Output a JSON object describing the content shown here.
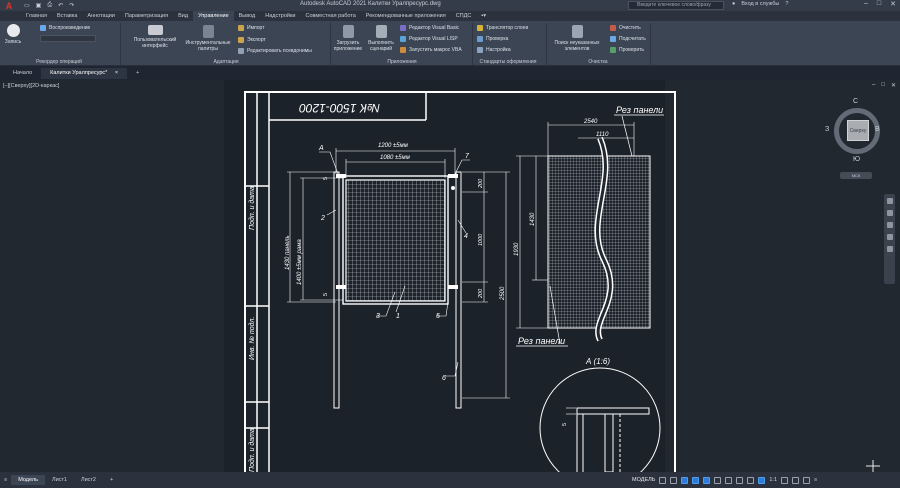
{
  "app": {
    "logo_letter": "A",
    "window_title": "Autodesk AutoCAD 2021    Калитки Уралпресурс.dwg",
    "search_placeholder": "Введите ключевое слово/фразу",
    "sign_in": "Вход в службы",
    "help": "?"
  },
  "quick_access": [
    "▭",
    "▣",
    "⎙",
    "↶",
    "↷"
  ],
  "ribbon_tabs": [
    {
      "label": "Главная",
      "active": false
    },
    {
      "label": "Вставка",
      "active": false
    },
    {
      "label": "Аннотации",
      "active": false
    },
    {
      "label": "Параметризация",
      "active": false
    },
    {
      "label": "Вид",
      "active": false
    },
    {
      "label": "Управление",
      "active": true
    },
    {
      "label": "Вывод",
      "active": false
    },
    {
      "label": "Надстройки",
      "active": false
    },
    {
      "label": "Совместная работа",
      "active": false
    },
    {
      "label": "Рекомендованные приложения",
      "active": false
    },
    {
      "label": "СПДС",
      "active": false
    }
  ],
  "ribbon": {
    "record": "Запись",
    "playback": "Воспроизведение",
    "recorder_panel": "Рекордер операций",
    "ui_button": "Пользовательский интерфейс",
    "tool_palettes": "Инструментальные палитры",
    "import": "Импорт",
    "export": "Экспорт",
    "edit_aliases": "Редактировать псевдонимы",
    "adaptation_panel": "Адаптация",
    "load_app": "Загрузить приложение",
    "run_script": "Выполнить сценарий",
    "vb_editor": "Редактор Visual Basic",
    "lisp_editor": "Редактор Visual LISP",
    "run_vba": "Запустить макрос VBA",
    "apps_panel": "Приложения",
    "layer_translator": "Транслятор слоев",
    "check": "Проверка",
    "configure": "Настройка",
    "standards_panel": "Стандарты оформления",
    "find_unref": "Поиск неуказанных элементов",
    "purge": "Очистить",
    "count": "Подсчитать",
    "audit": "Проверить",
    "cleanup_panel": "Очистка"
  },
  "doc_tabs": [
    {
      "label": "Начало",
      "active": false
    },
    {
      "label": "Калитки Уралпресурс*",
      "active": true
    },
    {
      "label": "+",
      "active": false
    }
  ],
  "viewport": {
    "label": "[–][Сверху][2D-каркас]"
  },
  "drawing": {
    "title_stamp": "№К 1500-1200",
    "section_label_top": "Рез панели",
    "section_label_bottom": "Рез панели",
    "detail_label": "А (1:6)",
    "callout_a": "А",
    "dim_top_outer": "1200 ±5мм",
    "dim_top_inner": "1080 ±5мм",
    "dim_side_panel": "1430 панель",
    "dim_side_frame": "1400 ±5мм рама",
    "dim_right_1": "200",
    "dim_right_2": "1000",
    "dim_right_3": "200",
    "dim_total": "2500",
    "dim_panel_width": "2540",
    "dim_panel_inner": "1110",
    "dim_panel_height": "1930",
    "dim_panel_mesh": "1430",
    "dim_small_5a": "5",
    "dim_small_5b": "5",
    "detail_dim": "5",
    "part_numbers": [
      "1",
      "2",
      "3",
      "4",
      "5",
      "6",
      "7"
    ],
    "side_labels": [
      "Подп. и дата",
      "Инв. № подл.",
      "Взам. инв. №",
      "Подп. и дата"
    ]
  },
  "viewcube": {
    "north": "С",
    "south": "Ю",
    "east": "В",
    "west": "З",
    "face": "Сверху",
    "wcs": "МСК"
  },
  "layout_tabs": [
    {
      "label": "Модель",
      "active": true
    },
    {
      "label": "Лист1",
      "active": false
    },
    {
      "label": "Лист2",
      "active": false
    },
    {
      "label": "+",
      "active": false
    }
  ],
  "status": {
    "model": "МОДЕЛЬ",
    "scale": "1:1"
  },
  "colors": {
    "accent": "#e4312b",
    "canvas": "#212830",
    "ribbon": "#3b4554"
  }
}
